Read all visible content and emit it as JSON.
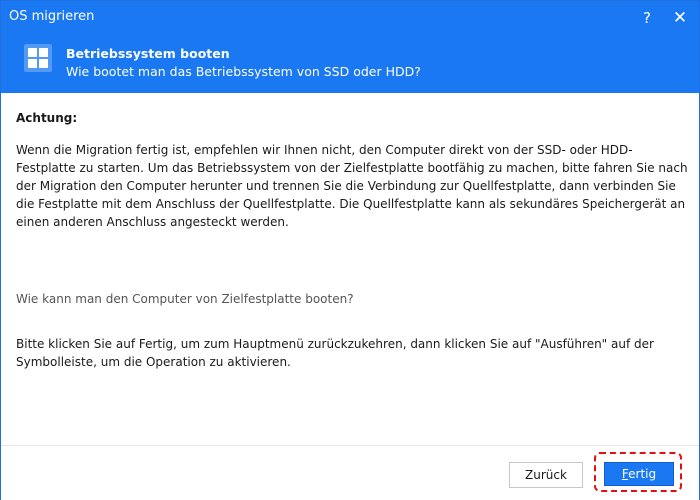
{
  "window": {
    "title": "OS migrieren"
  },
  "titlebar_buttons": {
    "help": "?",
    "close": "✕"
  },
  "header": {
    "icon": "windows-logo-icon",
    "title": "Betriebssystem booten",
    "subtitle": "Wie bootet man das Betriebssystem von SSD oder HDD?"
  },
  "content": {
    "warning_title": "Achtung:",
    "paragraph1": "Wenn die Migration fertig ist, empfehlen wir Ihnen nicht, den Computer direkt von der SSD- oder HDD-Festplatte zu starten. Um das Betriebssystem von der Zielfestplatte bootfähig zu machen, bitte fahren Sie nach der Migration den Computer herunter und trennen Sie die Verbindung zur Quellfestplatte, dann verbinden Sie die Festplatte mit dem Anschluss der Quellfestplatte. Die Quellfestplatte kann als sekundäres Speichergerät an einen anderen Anschluss angesteckt werden.",
    "question": "Wie kann man den Computer von Zielfestplatte booten?",
    "paragraph2": "Bitte klicken Sie auf Fertig, um zum Hauptmenü zurückzukehren, dann klicken Sie auf \"Ausführen\" auf der Symbolleiste, um die Operation zu aktivieren."
  },
  "footer": {
    "back_label": "Zurück",
    "finish_first_letter": "F",
    "finish_rest": "ertig"
  },
  "colors": {
    "accent": "#1a78f2",
    "highlight": "#e01010"
  }
}
